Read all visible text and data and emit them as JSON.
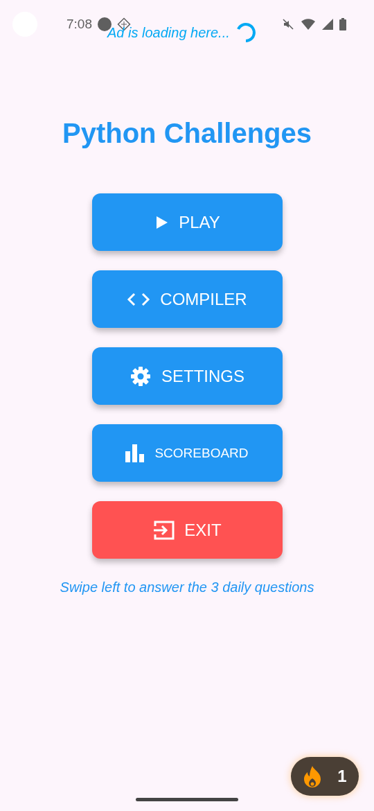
{
  "status_bar": {
    "time": "7:08"
  },
  "ad": {
    "text": "Ad is loading here..."
  },
  "title": "Python Challenges",
  "buttons": [
    {
      "label": "PLAY",
      "kind": "play",
      "color": "#2196f3"
    },
    {
      "label": "COMPILER",
      "kind": "code",
      "color": "#2196f3"
    },
    {
      "label": "SETTINGS",
      "kind": "gear",
      "color": "#2196f3"
    },
    {
      "label": "SCOREBOARD",
      "kind": "chart",
      "color": "#2196f3"
    },
    {
      "label": "EXIT",
      "kind": "exit",
      "color": "#ff5252"
    }
  ],
  "hint": "Swipe left to answer the 3 daily questions",
  "streak": {
    "count": "1"
  }
}
